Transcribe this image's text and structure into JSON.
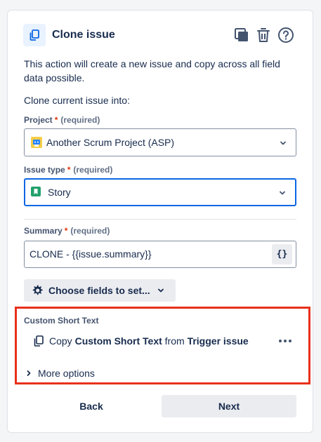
{
  "header": {
    "title": "Clone issue",
    "icons": [
      "copy-icon",
      "duplicate-icon",
      "trash-icon",
      "help-icon"
    ]
  },
  "description": "This action will create a new issue and copy across all field data possible.",
  "subtitle": "Clone current issue into:",
  "project": {
    "label": "Project",
    "required_mark": "*",
    "required_note": "(required)",
    "value": "Another Scrum Project (ASP)"
  },
  "issue_type": {
    "label": "Issue type",
    "required_mark": "*",
    "required_note": "(required)",
    "value": "Story"
  },
  "summary": {
    "label": "Summary",
    "required_mark": "*",
    "required_note": "(required)",
    "value": "CLONE - {{issue.summary}}",
    "smart_value_button": "{}"
  },
  "choose_fields_label": "Choose fields to set...",
  "custom_field": {
    "title": "Custom Short Text",
    "prefix": "Copy",
    "field_name": "Custom Short Text",
    "from_word": "from",
    "source": "Trigger issue"
  },
  "more_options_label": "More options",
  "buttons": {
    "back": "Back",
    "next": "Next"
  },
  "colors": {
    "highlight_border": "#e8301c",
    "focus_border": "#0c66e4",
    "required": "#de350b",
    "story_icon": "#22a06b",
    "project_icon": "#f5cd47"
  }
}
